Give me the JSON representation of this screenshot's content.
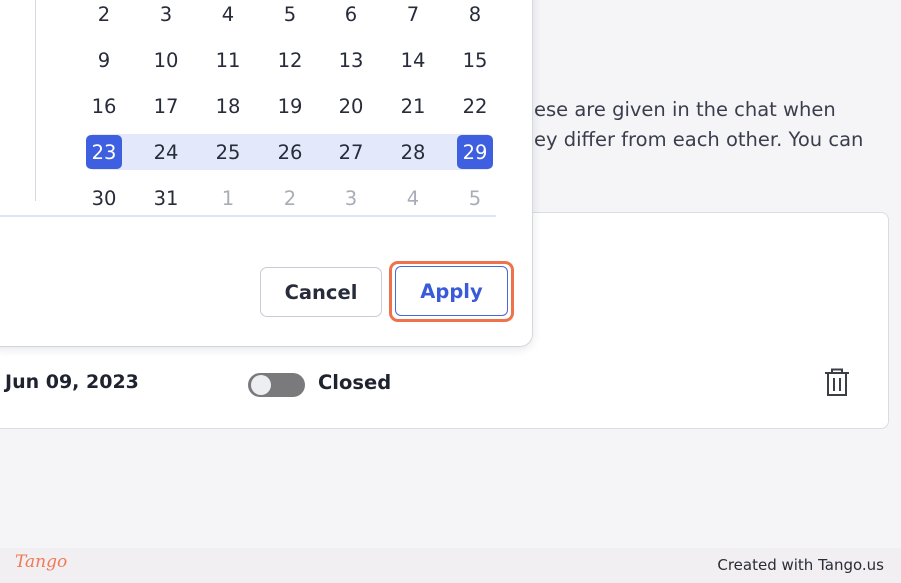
{
  "background": {
    "paragraph_line1": "ese are given in the chat when",
    "paragraph_line2": "ey differ from each other. You can"
  },
  "schedule_row": {
    "date": "Jun 09, 2023",
    "toggle_label": "Closed",
    "toggle_on": false
  },
  "calendar": {
    "weeks": [
      [
        {
          "d": "2"
        },
        {
          "d": "3"
        },
        {
          "d": "4"
        },
        {
          "d": "5"
        },
        {
          "d": "6"
        },
        {
          "d": "7"
        },
        {
          "d": "8"
        }
      ],
      [
        {
          "d": "9"
        },
        {
          "d": "10"
        },
        {
          "d": "11"
        },
        {
          "d": "12"
        },
        {
          "d": "13"
        },
        {
          "d": "14"
        },
        {
          "d": "15"
        }
      ],
      [
        {
          "d": "16"
        },
        {
          "d": "17"
        },
        {
          "d": "18"
        },
        {
          "d": "19"
        },
        {
          "d": "20"
        },
        {
          "d": "21"
        },
        {
          "d": "22"
        }
      ],
      [
        {
          "d": "23",
          "selected": true
        },
        {
          "d": "24"
        },
        {
          "d": "25"
        },
        {
          "d": "26"
        },
        {
          "d": "27"
        },
        {
          "d": "28"
        },
        {
          "d": "29",
          "selected": true
        }
      ],
      [
        {
          "d": "30"
        },
        {
          "d": "31"
        },
        {
          "d": "1",
          "muted": true
        },
        {
          "d": "2",
          "muted": true
        },
        {
          "d": "3",
          "muted": true
        },
        {
          "d": "4",
          "muted": true
        },
        {
          "d": "5",
          "muted": true
        }
      ]
    ],
    "cancel_label": "Cancel",
    "apply_label": "Apply"
  },
  "footer": {
    "logo": "Tango",
    "credit": "Created with Tango.us"
  },
  "colors": {
    "accent": "#3d5fe0",
    "range": "#e4e8fb",
    "highlight": "#f0724a"
  }
}
